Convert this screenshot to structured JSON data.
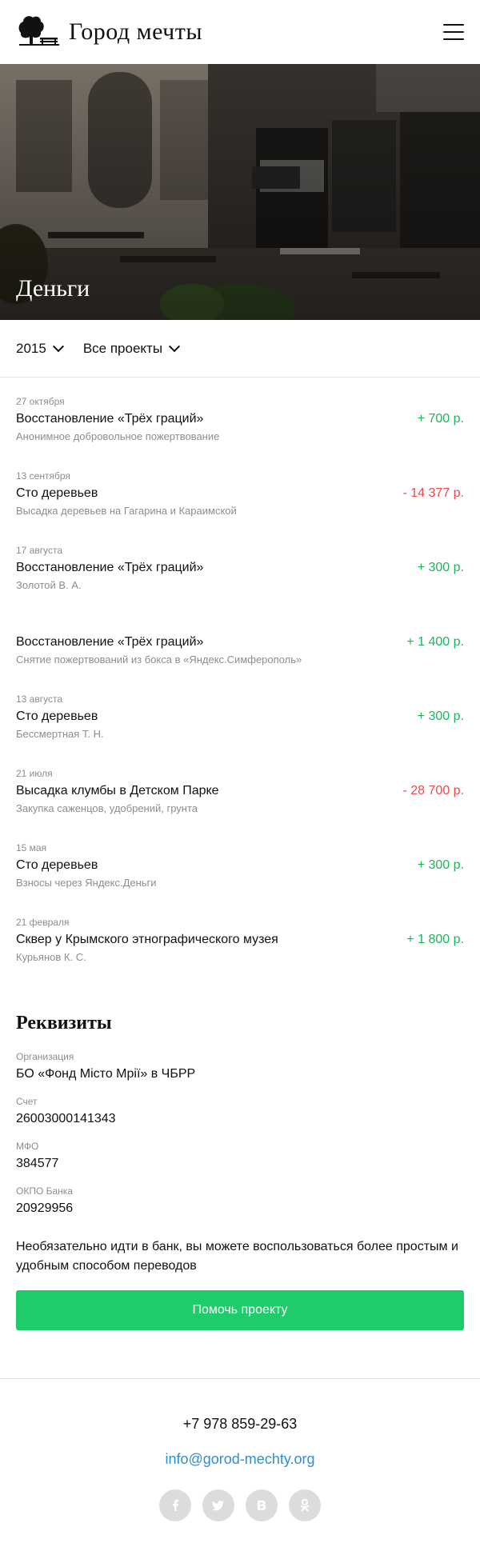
{
  "header": {
    "logo_text": "Город мечты",
    "logo_icon": "tree-and-bench-icon",
    "menu_icon": "hamburger-menu-icon"
  },
  "hero": {
    "title": "Деньги"
  },
  "filters": {
    "year": "2015",
    "project": "Все проекты"
  },
  "transactions": [
    {
      "date": "27 октября",
      "title": "Восстановление «Трёх граций»",
      "desc": "Анонимное добровольное пожертвование",
      "amount": "+ 700 р.",
      "type": "in"
    },
    {
      "date": "13 сентября",
      "title": "Сто деревьев",
      "desc": "Высадка деревьев на Гагарина и Караимской",
      "amount": "- 14 377 р.",
      "type": "out"
    },
    {
      "date": "17 августа",
      "title": "Восстановление «Трёх граций»",
      "desc": "Золотой В. А.",
      "amount": "+ 300 р.",
      "type": "in"
    },
    {
      "date": "",
      "title": "Восстановление «Трёх граций»",
      "desc": "Снятие пожертвований из бокса в «Яндекс.Симферополь»",
      "amount": "+ 1 400 р.",
      "type": "in"
    },
    {
      "date": "13 августа",
      "title": "Сто деревьев",
      "desc": "Бессмертная Т. Н.",
      "amount": "+ 300 р.",
      "type": "in"
    },
    {
      "date": "21 июля",
      "title": "Высадка клумбы в Детском Парке",
      "desc": "Закупка саженцов, удобрений, грунта",
      "amount": "- 28 700 р.",
      "type": "out"
    },
    {
      "date": "15 мая",
      "title": "Сто деревьев",
      "desc": "Взносы через Яндекс.Деньги",
      "amount": "+ 300 р.",
      "type": "in"
    },
    {
      "date": "21 февраля",
      "title": "Сквер у Крымского этнографического музея",
      "desc": "Курьянов К. С.",
      "amount": "+ 1 800 р.",
      "type": "in"
    }
  ],
  "requisites": {
    "heading": "Реквизиты",
    "items": [
      {
        "label": "Организация",
        "value": "БО «Фонд Місто Мрії» в ЧБРР"
      },
      {
        "label": "Счет",
        "value": "26003000141343"
      },
      {
        "label": "МФО",
        "value": "384577"
      },
      {
        "label": "ОКПО Банка",
        "value": "20929956"
      }
    ],
    "note": "Необязательно идти в банк, вы можете воспользоваться более простым и удобным способом переводов",
    "button": "Помочь проекту"
  },
  "footer": {
    "phone": "+7 978 859-29-63",
    "email": "info@gorod-mechty.org",
    "socials": [
      "facebook-icon",
      "twitter-icon",
      "vk-icon",
      "odnoklassniki-icon"
    ]
  },
  "colors": {
    "income": "#1fb35c",
    "expense": "#ef4848",
    "button": "#1ecc6a",
    "link": "#2d8fd5"
  }
}
